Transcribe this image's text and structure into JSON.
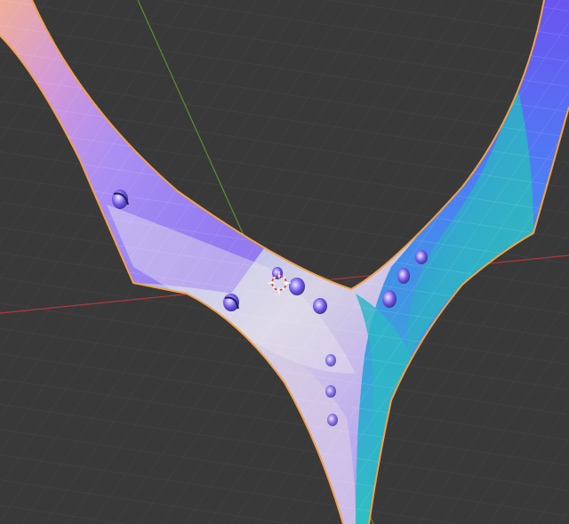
{
  "viewport": {
    "kind": "3d-viewport",
    "shading": "normal-map-material",
    "colors": {
      "background": "#393939",
      "grid_minor": "#434343",
      "grid_major": "#4a4a4a",
      "axis_x": "#b0383a",
      "axis_y": "#5d8f2a",
      "selection_outline": "#f2a14a",
      "normal_purple": "#8a6cf0",
      "normal_blue": "#4f7cf5",
      "normal_cyan": "#34b7c7",
      "normal_peach": "#e6b3a3",
      "normal_pale": "#cfc8e6",
      "cursor_ring": "#ffffff",
      "cursor_dash": "#d23a3a"
    },
    "icons": {
      "cursor": "3d-cursor-icon"
    }
  }
}
